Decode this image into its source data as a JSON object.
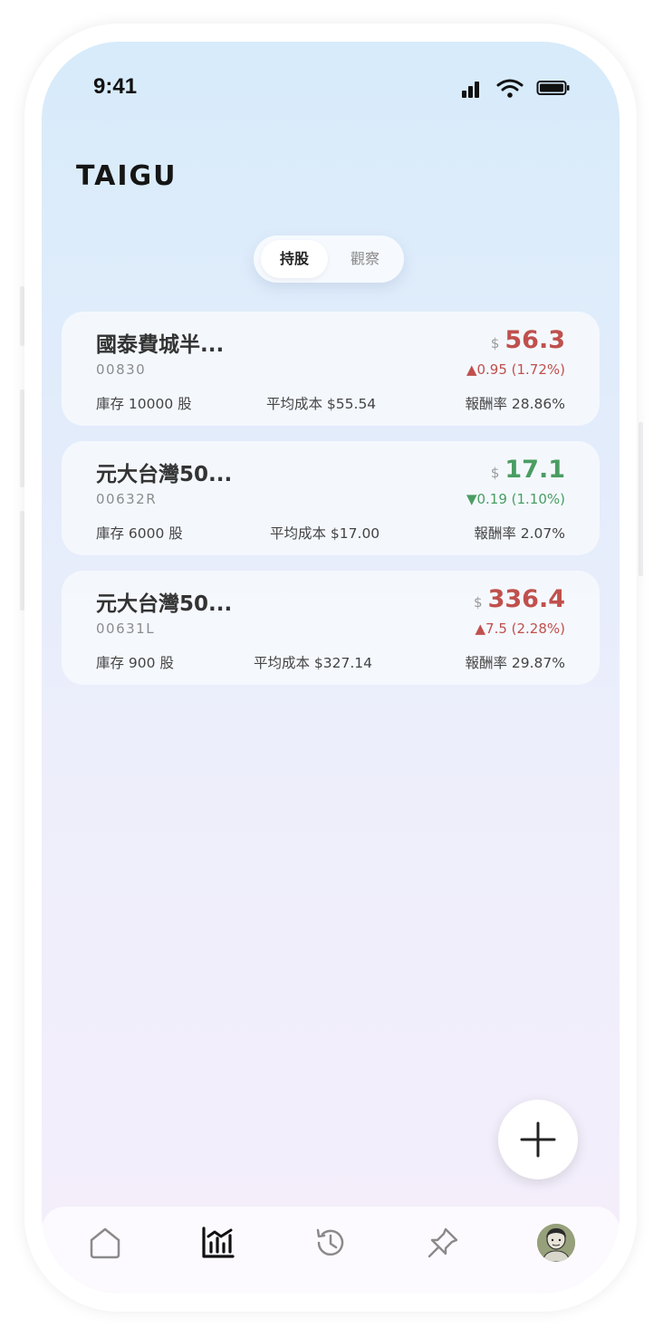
{
  "status_bar": {
    "time": "9:41"
  },
  "app": {
    "logo": "TAIGU"
  },
  "segmented": {
    "items": [
      {
        "label": "持股",
        "active": true
      },
      {
        "label": "觀察",
        "active": false
      }
    ]
  },
  "colors": {
    "up": "#c0504d",
    "down": "#4a9d62"
  },
  "holdings": [
    {
      "name": "國泰費城半...",
      "code": "00830",
      "currency": "$",
      "price": "56.3",
      "direction": "up",
      "change": "▲0.95 (1.72%)",
      "quantity": "庫存 10000 股",
      "avg_cost": "平均成本 $55.54",
      "return_rate": "報酬率 28.86%"
    },
    {
      "name": "元大台灣50...",
      "code": "00632R",
      "currency": "$",
      "price": "17.1",
      "direction": "down",
      "change": "▼0.19 (1.10%)",
      "quantity": "庫存 6000 股",
      "avg_cost": "平均成本 $17.00",
      "return_rate": "報酬率 2.07%"
    },
    {
      "name": "元大台灣50...",
      "code": "00631L",
      "currency": "$",
      "price": "336.4",
      "direction": "up",
      "change": "▲7.5 (2.28%)",
      "quantity": "庫存 900 股",
      "avg_cost": "平均成本 $327.14",
      "return_rate": "報酬率 29.87%"
    }
  ],
  "fab": {
    "icon": "plus-icon"
  },
  "tabbar": {
    "items": [
      {
        "icon": "home-icon",
        "active": false
      },
      {
        "icon": "chart-icon",
        "active": true
      },
      {
        "icon": "history-icon",
        "active": false
      },
      {
        "icon": "pin-icon",
        "active": false
      },
      {
        "icon": "avatar",
        "active": false
      }
    ]
  }
}
